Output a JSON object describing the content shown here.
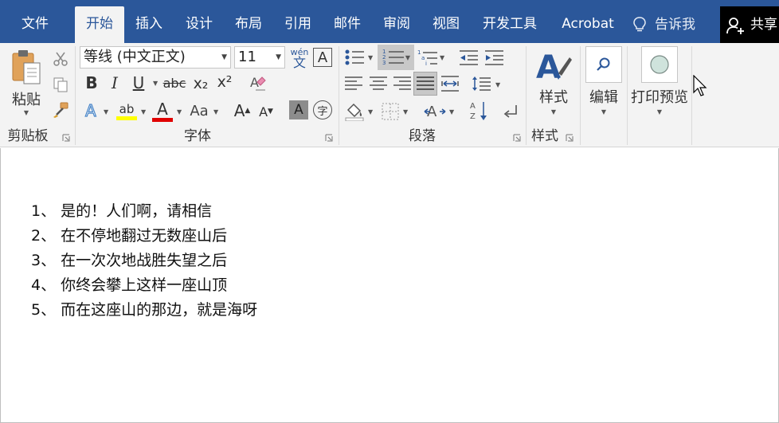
{
  "tabs": {
    "file": "文件",
    "home": "开始",
    "insert": "插入",
    "design": "设计",
    "layout": "布局",
    "references": "引用",
    "mailings": "邮件",
    "review": "审阅",
    "view": "视图",
    "developer": "开发工具",
    "acrobat": "Acrobat",
    "tell_me": "告诉我",
    "share": "共享"
  },
  "ribbon": {
    "clipboard": {
      "paste_label": "粘贴",
      "group_label": "剪贴板"
    },
    "font": {
      "font_name": "等线 (中文正文)",
      "font_size": "11",
      "phonetic_pinyin": "wén",
      "phonetic_char": "文",
      "border_char": "A",
      "bold": "B",
      "italic": "I",
      "underline": "U",
      "strikethrough": "abc",
      "subscript": "x₂",
      "superscript": "x²",
      "highlight_text": "ab",
      "font_color_text": "A",
      "change_case": "Aa",
      "grow": "A",
      "shrink": "A",
      "shading_char": "A",
      "enclose_char": "字",
      "group_label": "字体",
      "highlight_color": "#ffff00",
      "font_color": "#e00000"
    },
    "paragraph": {
      "group_label": "段落"
    },
    "styles": {
      "styles_label": "样式",
      "group_label": "样式"
    },
    "editing": {
      "label": "编辑"
    },
    "print_preview": {
      "label": "打印预览"
    }
  },
  "document": {
    "lines": [
      "1、 是的！人们啊，请相信",
      "2、 在不停地翻过无数座山后",
      "3、 在一次次地战胜失望之后",
      "4、 你终会攀上这样一座山顶",
      "5、 而在这座山的那边，就是海呀"
    ]
  },
  "colors": {
    "accent": "#2b579a",
    "ribbon_bg": "#f3f3f3",
    "share_bg": "#000000"
  }
}
